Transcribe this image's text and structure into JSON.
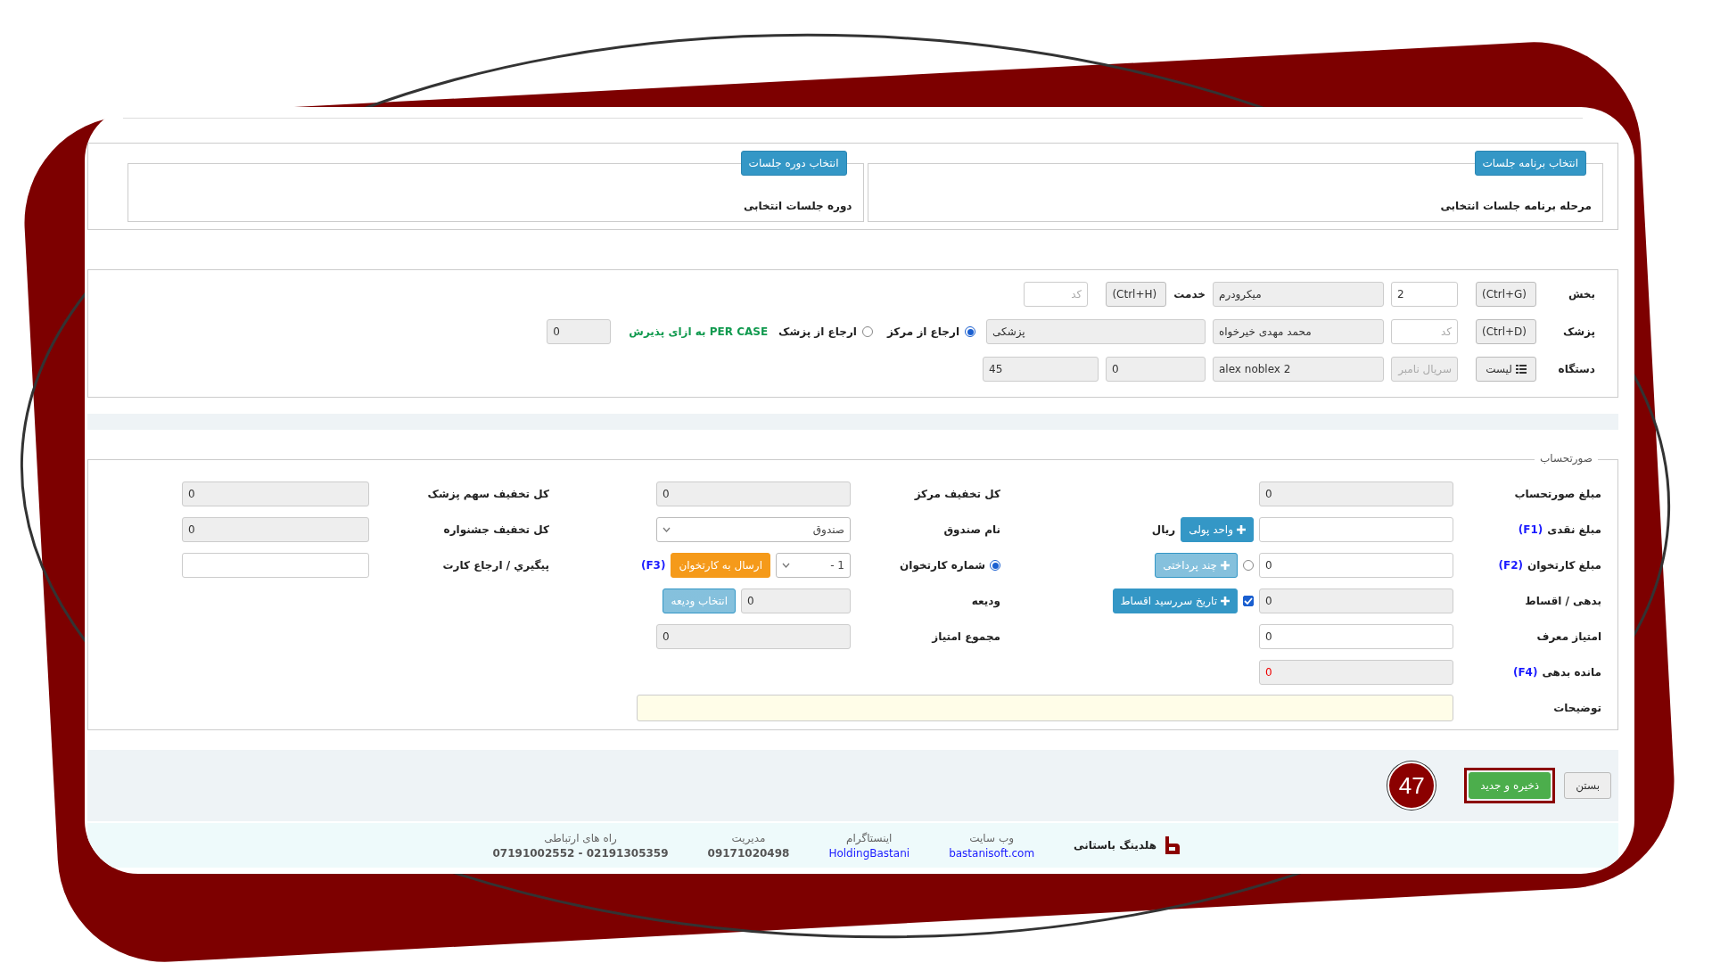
{
  "sessions": [
    {
      "button": "انتخاب برنامه جلسات",
      "label": "مرحله برنامه جلسات انتخابی"
    },
    {
      "button": "انتخاب دوره جلسات",
      "label": "دوره جلسات انتخابی"
    }
  ],
  "reception": [
    {
      "label": "بخش",
      "items": [
        {
          "kind": "button",
          "text": "(Ctrl+G)"
        },
        {
          "kind": "input",
          "value": "2",
          "readonly": false
        },
        {
          "kind": "input",
          "value": "میکرودرم",
          "readonly": true
        },
        {
          "kind": "label",
          "text": "خدمت"
        },
        {
          "kind": "button",
          "text": "(Ctrl+H)"
        },
        {
          "kind": "input",
          "placeholder": "کد",
          "readonly": false
        }
      ]
    },
    {
      "label": "پزشک",
      "items": [
        {
          "kind": "button",
          "text": "(Ctrl+D)"
        },
        {
          "kind": "input",
          "placeholder": "کد",
          "readonly": false
        },
        {
          "kind": "input",
          "value": "محمد مهدی خیرخواه",
          "readonly": true
        },
        {
          "kind": "input",
          "value": "پزشکی",
          "readonly": true
        },
        {
          "kind": "radio",
          "text": "ارجاع از مرکز",
          "selected": true
        },
        {
          "kind": "radio",
          "text": "ارجاع از پزشک",
          "selected": false
        },
        {
          "kind": "note",
          "text": "PER CASE به ازای پذیرش"
        },
        {
          "kind": "input",
          "value": "0",
          "readonly": true
        }
      ]
    },
    {
      "label": "دستگاه",
      "items": [
        {
          "kind": "button",
          "text": "لیست"
        },
        {
          "kind": "input",
          "placeholder": "سریال نامبر",
          "readonly": true
        },
        {
          "kind": "input",
          "value": "alex noblex 2",
          "readonly": true
        },
        {
          "kind": "input",
          "value": "0",
          "readonly": true
        },
        {
          "kind": "input",
          "value": "45",
          "readonly": true
        }
      ]
    }
  ],
  "invoice": {
    "legend": "صورتحساب",
    "columns": [
      {
        "rows": [
          {
            "label": "مبلغ صورتحساب",
            "items": [
              {
                "kind": "input",
                "value": "0",
                "readonly": true
              }
            ]
          },
          {
            "label": "مبلغ نقدی",
            "hint": "(F1)",
            "items": [
              {
                "kind": "input",
                "readonly": false
              },
              {
                "kind": "add-button",
                "text": "واحد پولی",
                "color": "#3497c6",
                "disabled": false
              },
              {
                "kind": "text",
                "text": "ریال"
              }
            ]
          },
          {
            "label": "مبلغ کارتخوان",
            "hint": "(F2)",
            "items": [
              {
                "kind": "input",
                "value": "0",
                "readonly": false
              },
              {
                "kind": "radio",
                "selected": false
              },
              {
                "kind": "add-button",
                "text": "چند پرداختی",
                "color": "#3497c6",
                "disabled": true
              }
            ]
          },
          {
            "label": "بدهی / اقساط",
            "items": [
              {
                "kind": "input",
                "value": "0",
                "readonly": true
              },
              {
                "kind": "checkbox",
                "checked": true
              },
              {
                "kind": "add-button",
                "text": "تاریخ سررسید اقساط",
                "color": "#3497c6",
                "disabled": false
              }
            ]
          },
          {
            "label": "امتیاز معرف",
            "items": [
              {
                "kind": "input",
                "value": "0",
                "readonly": false
              }
            ]
          },
          {
            "label": "مانده بدهی",
            "hint": "(F4)",
            "items": [
              {
                "kind": "input",
                "value": "0",
                "readonly": true,
                "alert": true
              }
            ]
          }
        ]
      },
      {
        "rows": [
          {
            "label": "کل تخفیف مرکز",
            "items": [
              {
                "kind": "input",
                "value": "0",
                "readonly": true
              }
            ]
          },
          {
            "label": "نام صندوق",
            "items": [
              {
                "kind": "select",
                "value": "صندوق"
              }
            ]
          },
          {
            "label": "شماره کارتخوان",
            "selected": true,
            "items": [
              {
                "kind": "select",
                "value": "1 -"
              },
              {
                "kind": "button",
                "text": "ارسال به کارتخوان",
                "color": "#f59a1a",
                "disabled": false
              },
              {
                "kind": "hint",
                "text": "(F3)"
              }
            ]
          },
          {
            "label": "ودیعه",
            "items": [
              {
                "kind": "input",
                "value": "0",
                "readonly": true
              },
              {
                "kind": "button",
                "text": "انتخاب ودیعه",
                "color": "#3497c6",
                "disabled": true
              }
            ]
          },
          {
            "label": "مجموع امتیاز",
            "items": [
              {
                "kind": "input",
                "value": "0",
                "readonly": true
              }
            ]
          }
        ]
      },
      {
        "rows": [
          {
            "label": "کل تخفیف سهم پزشک",
            "items": [
              {
                "kind": "input",
                "value": "0",
                "readonly": true
              }
            ]
          },
          {
            "label": "کل تخفیف جشنواره",
            "items": [
              {
                "kind": "input",
                "value": "0",
                "readonly": true
              }
            ]
          },
          {
            "label": "پیگیري / ارجاع کارت",
            "items": [
              {
                "kind": "input",
                "readonly": false
              }
            ]
          }
        ]
      }
    ],
    "notes": {
      "label": "توضیحات"
    }
  },
  "actions": [
    {
      "text": "بستن",
      "color": "#eeeeee",
      "highlighted": false
    },
    {
      "text": "ذخیره و جدید",
      "color": "#4cae4c",
      "highlighted": true
    }
  ],
  "step_badge": "47",
  "company": {
    "name": "هلدینگ باستانی",
    "contacts": [
      {
        "title": "وب سایت",
        "value": "bastanisoft.com",
        "link": true
      },
      {
        "title": "اینستاگرام",
        "value": "HoldingBastani",
        "link": true
      },
      {
        "title": "مدیریت",
        "value": "09171020498",
        "link": false
      },
      {
        "title": "راه های ارتباطی",
        "value": "07191002552 - 02191305359",
        "link": false
      }
    ]
  }
}
